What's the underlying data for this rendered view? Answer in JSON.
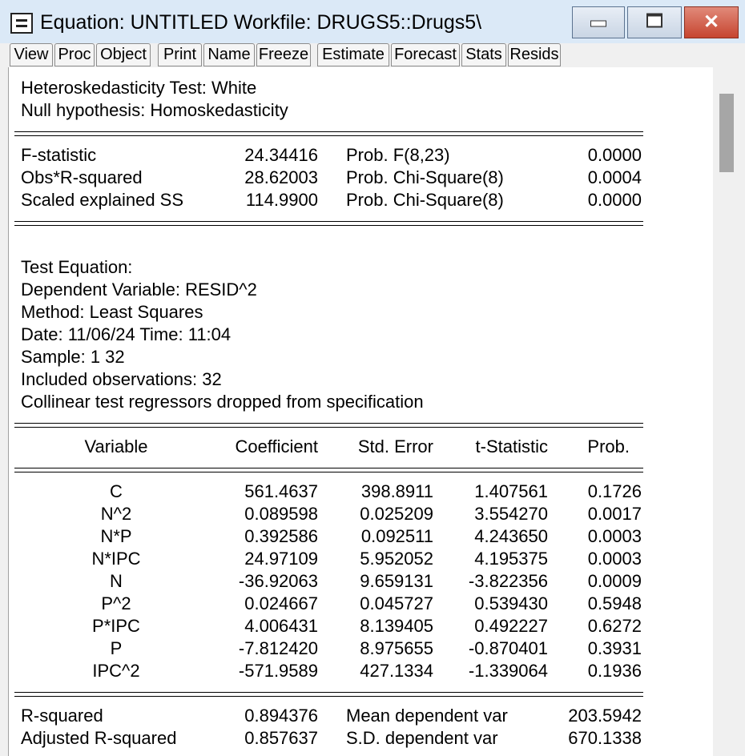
{
  "window": {
    "title": "Equation: UNTITLED    Workfile: DRUGS5::Drugs5\\"
  },
  "toolbar": [
    "View",
    "Proc",
    "Object",
    "Print",
    "Name",
    "Freeze",
    "Estimate",
    "Forecast",
    "Stats",
    "Resids"
  ],
  "header": {
    "line1": "Heteroskedasticity Test: White",
    "line2": "Null hypothesis: Homoskedasticity"
  },
  "test_stats": [
    {
      "label": "F-statistic",
      "value": "24.34416",
      "prob_label": "Prob. F(8,23)",
      "prob": "0.0000"
    },
    {
      "label": "Obs*R-squared",
      "value": "28.62003",
      "prob_label": "Prob. Chi-Square(8)",
      "prob": "0.0004"
    },
    {
      "label": "Scaled explained SS",
      "value": "114.9900",
      "prob_label": "Prob. Chi-Square(8)",
      "prob": "0.0000"
    }
  ],
  "test_equation": [
    "Test Equation:",
    "Dependent Variable: RESID^2",
    "Method: Least Squares",
    "Date: 11/06/24   Time: 11:04",
    "Sample: 1 32",
    "Included observations: 32",
    "Collinear test regressors dropped from specification"
  ],
  "table": {
    "headers": [
      "Variable",
      "Coefficient",
      "Std. Error",
      "t-Statistic",
      "Prob."
    ],
    "rows": [
      [
        "C",
        "561.4637",
        "398.8911",
        "1.407561",
        "0.1726"
      ],
      [
        "N^2",
        "0.089598",
        "0.025209",
        "3.554270",
        "0.0017"
      ],
      [
        "N*P",
        "0.392586",
        "0.092511",
        "4.243650",
        "0.0003"
      ],
      [
        "N*IPC",
        "24.97109",
        "5.952052",
        "4.195375",
        "0.0003"
      ],
      [
        "N",
        "-36.92063",
        "9.659131",
        "-3.822356",
        "0.0009"
      ],
      [
        "P^2",
        "0.024667",
        "0.045727",
        "0.539430",
        "0.5948"
      ],
      [
        "P*IPC",
        "4.006431",
        "8.139405",
        "0.492227",
        "0.6272"
      ],
      [
        "P",
        "-7.812420",
        "8.975655",
        "-0.870401",
        "0.3931"
      ],
      [
        "IPC^2",
        "-571.9589",
        "427.1334",
        "-1.339064",
        "0.1936"
      ]
    ]
  },
  "summary": [
    {
      "label": "R-squared",
      "value": "0.894376",
      "label2": "Mean dependent var",
      "value2": "203.5942"
    },
    {
      "label": "Adjusted R-squared",
      "value": "0.857637",
      "label2": "S.D. dependent var",
      "value2": "670.1338"
    }
  ]
}
